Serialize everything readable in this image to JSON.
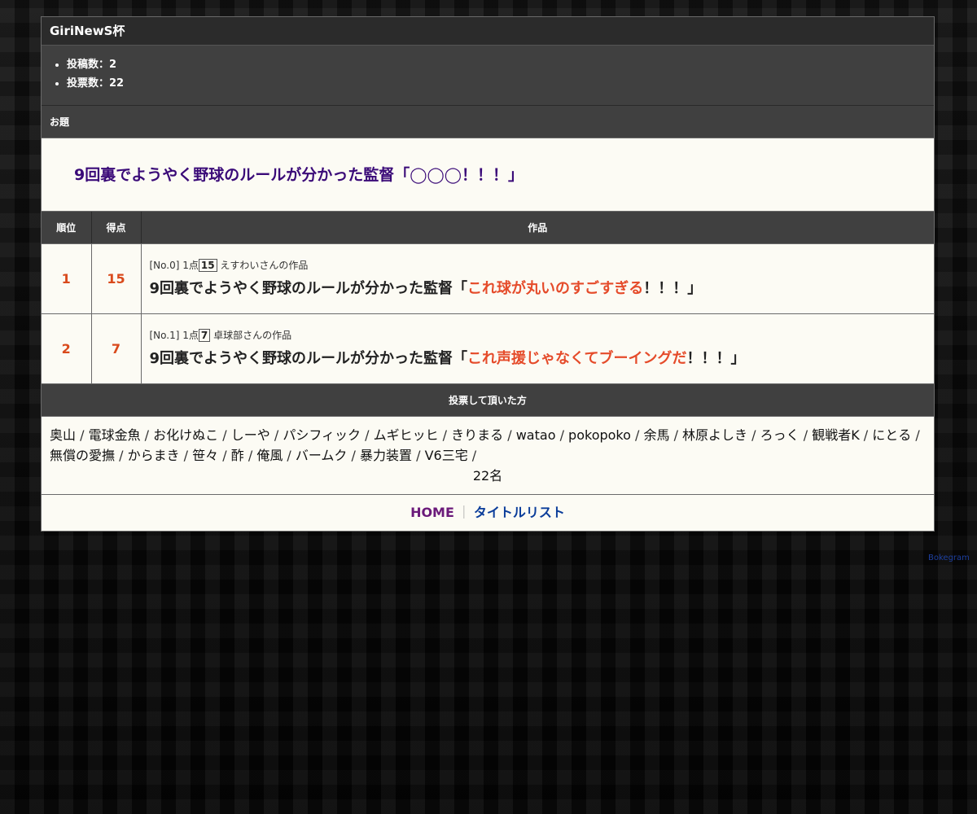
{
  "header": {
    "title": "GiriNewS杯"
  },
  "stats": {
    "items": [
      "投稿数：2",
      "投票数：22"
    ]
  },
  "theme": {
    "label": "お題",
    "text": "9回裏でようやく野球のルールが分かった監督「◯◯◯！！！」"
  },
  "table": {
    "headers": {
      "rank": "順位",
      "score": "得点",
      "work": "作品"
    },
    "rows": [
      {
        "rank": "1",
        "score": "15",
        "meta_prefix": "[No.0] 1点",
        "meta_points": "15",
        "meta_author": "えすわいさんの作品",
        "work_before": "9回裏でようやく野球のルールが分かった監督「",
        "work_answer": "これ球が丸いのすごすぎる",
        "work_after": "！！！」"
      },
      {
        "rank": "2",
        "score": "7",
        "meta_prefix": "[No.1] 1点",
        "meta_points": "7",
        "meta_author": "卓球部さんの作品",
        "work_before": "9回裏でようやく野球のルールが分かった監督「",
        "work_answer": "これ声援じゃなくてブーイングだ",
        "work_after": "！！！」"
      }
    ]
  },
  "voters": {
    "label": "投票して頂いた方",
    "names": [
      "奥山",
      "電球金魚",
      "お化けぬこ",
      "しーや",
      "パシフィック",
      "ムギヒッヒ",
      "きりまる",
      "watao",
      "pokopoko",
      "余馬",
      "林原よしき",
      "ろっく",
      "観戦者K",
      "にとる",
      "無償の愛撫",
      "からまき",
      "笹々",
      "酢",
      "俺風",
      "バームク",
      "暴力装置",
      "V6三宅"
    ],
    "separator": " / ",
    "count": "22名"
  },
  "footer": {
    "home": "HOME",
    "separator": "｜",
    "title_list": "タイトルリスト"
  },
  "credit": "Bokegram"
}
